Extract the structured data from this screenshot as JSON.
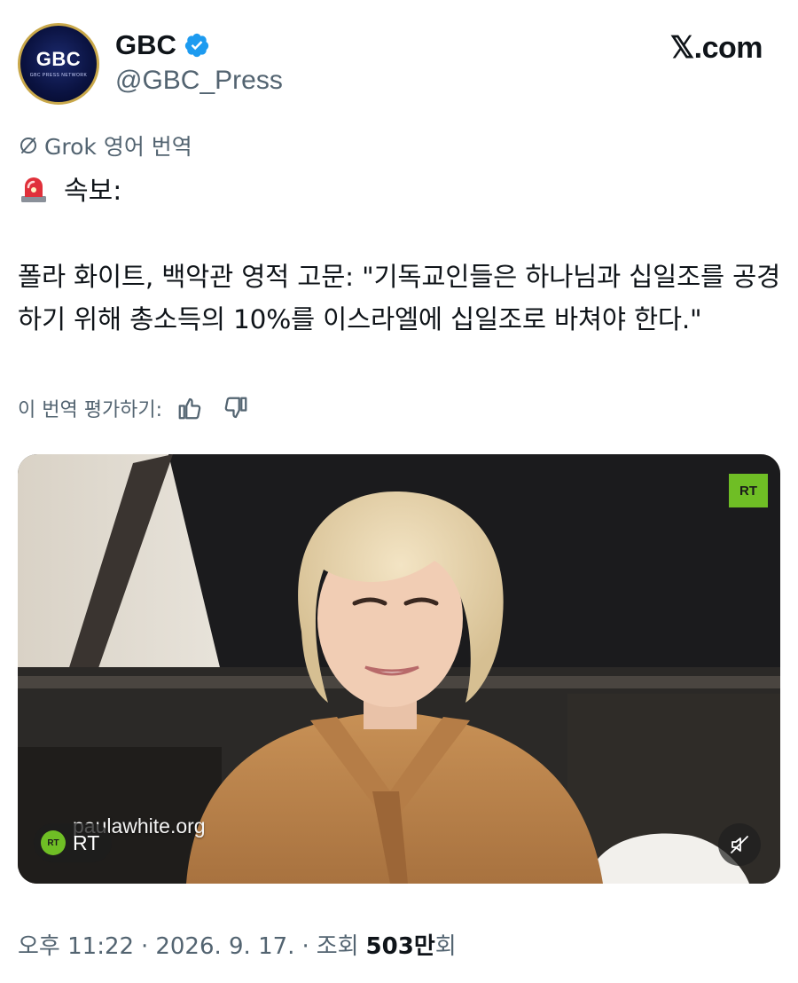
{
  "header": {
    "avatar_text": "GBC",
    "avatar_subtext": "GBC PRESS NETWORK",
    "author_name": "GBC",
    "handle": "@GBC_Press",
    "site": "𝕏.com"
  },
  "translation": {
    "label": "Grok 영어 번역",
    "rate_label": "이 번역 평가하기:"
  },
  "post": {
    "headline": "속보:",
    "body": "폴라 화이트, 백악관 영적 고문: \"기독교인들은 하나님과 십일조를 공경하기 위해 총소득의 10%를 이스라엘에 십일조로 바쳐야 한다.\""
  },
  "media": {
    "channel_badge": "RT",
    "watermark": "paulawhite.org",
    "source_label": "RT",
    "source_badge": "RT"
  },
  "meta": {
    "time": "오후 11:22",
    "separator": "·",
    "date": "2026. 9. 17.",
    "views_label": "조회",
    "views_value": "503만",
    "views_suffix": "회"
  },
  "colors": {
    "verified": "#1d9bf0",
    "secondary_text": "#536471",
    "primary_text": "#0f1419",
    "rt_green": "#6fbe25"
  },
  "icons": [
    "verified-badge-icon",
    "grok-icon",
    "siren-icon",
    "thumbs-up-icon",
    "thumbs-down-icon",
    "mute-icon"
  ]
}
